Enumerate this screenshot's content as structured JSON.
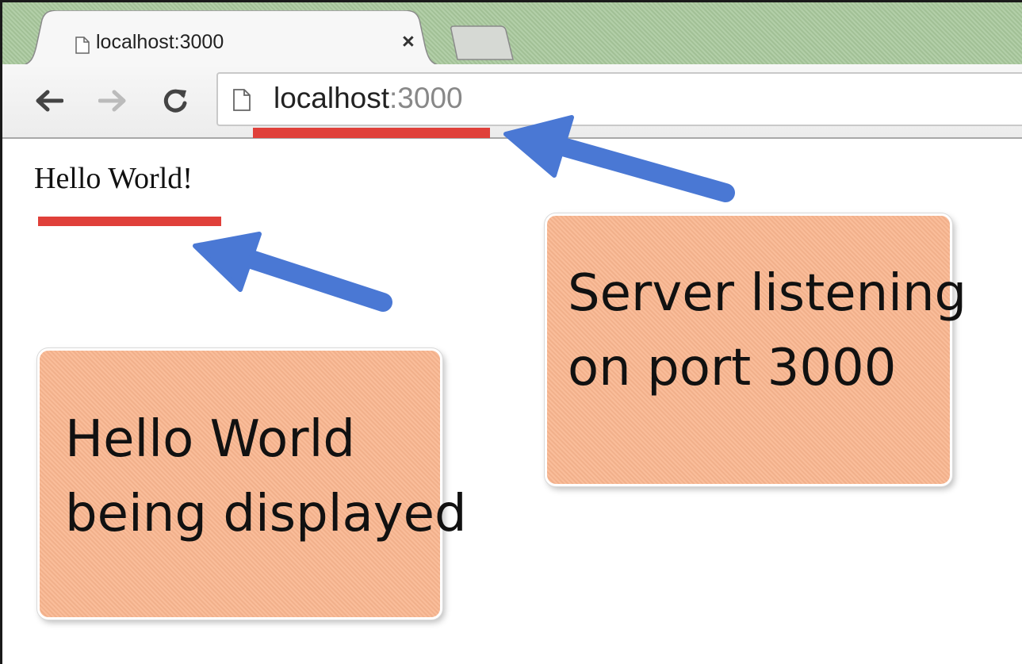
{
  "browser": {
    "tab": {
      "title": "localhost:3000",
      "close_symbol": "×",
      "favicon": "page-icon"
    },
    "toolbar": {
      "back_icon": "arrow-left-icon",
      "forward_icon": "arrow-right-icon",
      "reload_icon": "reload-icon"
    },
    "omnibox": {
      "host": "localhost",
      "port": ":3000"
    }
  },
  "page": {
    "content_text": "Hello World!"
  },
  "annotations": {
    "right_note": {
      "line1": "Server listening",
      "line2": "on port 3000"
    },
    "left_note": {
      "line1": "Hello World",
      "line2": "being displayed"
    },
    "underline_color": "#e0403a",
    "arrow_color": "#4a78d4",
    "note_color": "#f9b68f"
  }
}
